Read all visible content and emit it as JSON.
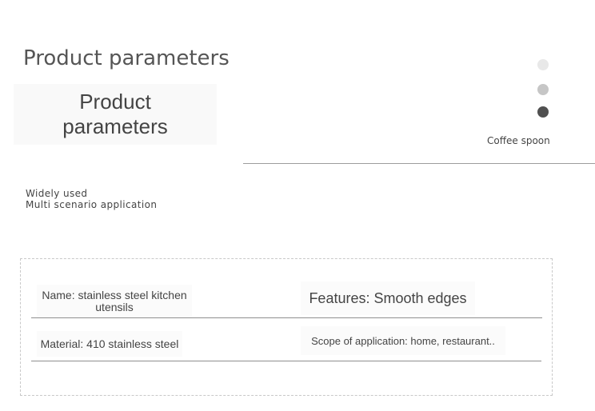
{
  "header": {
    "title": "Product parameters",
    "title_box_text": "Product parameters"
  },
  "slider": {
    "dots": [
      {
        "color": "#e8e8e8",
        "active": false
      },
      {
        "color": "#c6c6c6",
        "active": false
      },
      {
        "color": "#505050",
        "active": true
      }
    ],
    "product_name": "Coffee spoon"
  },
  "usage": {
    "line1": "Widely used",
    "line2": "Multi scenario application"
  },
  "parameters": {
    "name": "Name: stainless steel kitchen utensils",
    "features": "Features: Smooth edges",
    "material": "Material: 410 stainless steel",
    "scope": "Scope of application: home, restaurant.."
  }
}
